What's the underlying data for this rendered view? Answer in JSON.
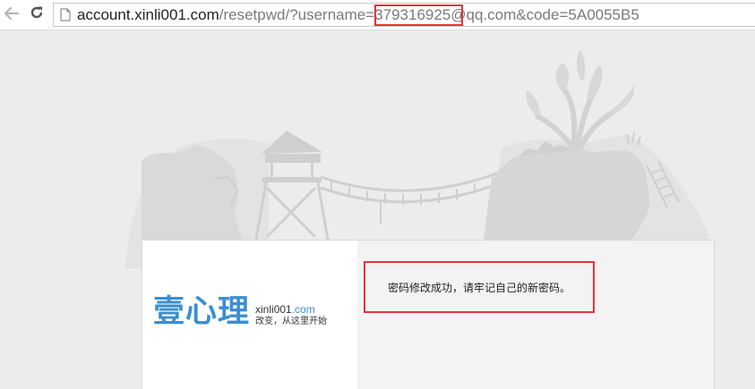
{
  "browser": {
    "back_icon": "arrow-left-icon",
    "reload_icon": "reload-icon",
    "page_icon": "document-icon",
    "url_host": "account.xinli001.com",
    "url_path": "/resetpwd/?username=379316925@qq.com&code=5A0055B5",
    "highlight_color": "#e5333a"
  },
  "logo": {
    "main": "壹心理",
    "domain_name": "xinli001",
    "domain_tld": ".com",
    "slogan": "改变，从这里开始",
    "brand_color": "#3a8fd0"
  },
  "message": {
    "text": "密码修改成功，请牢记自己的新密码。",
    "highlight_color": "#e5333a"
  }
}
